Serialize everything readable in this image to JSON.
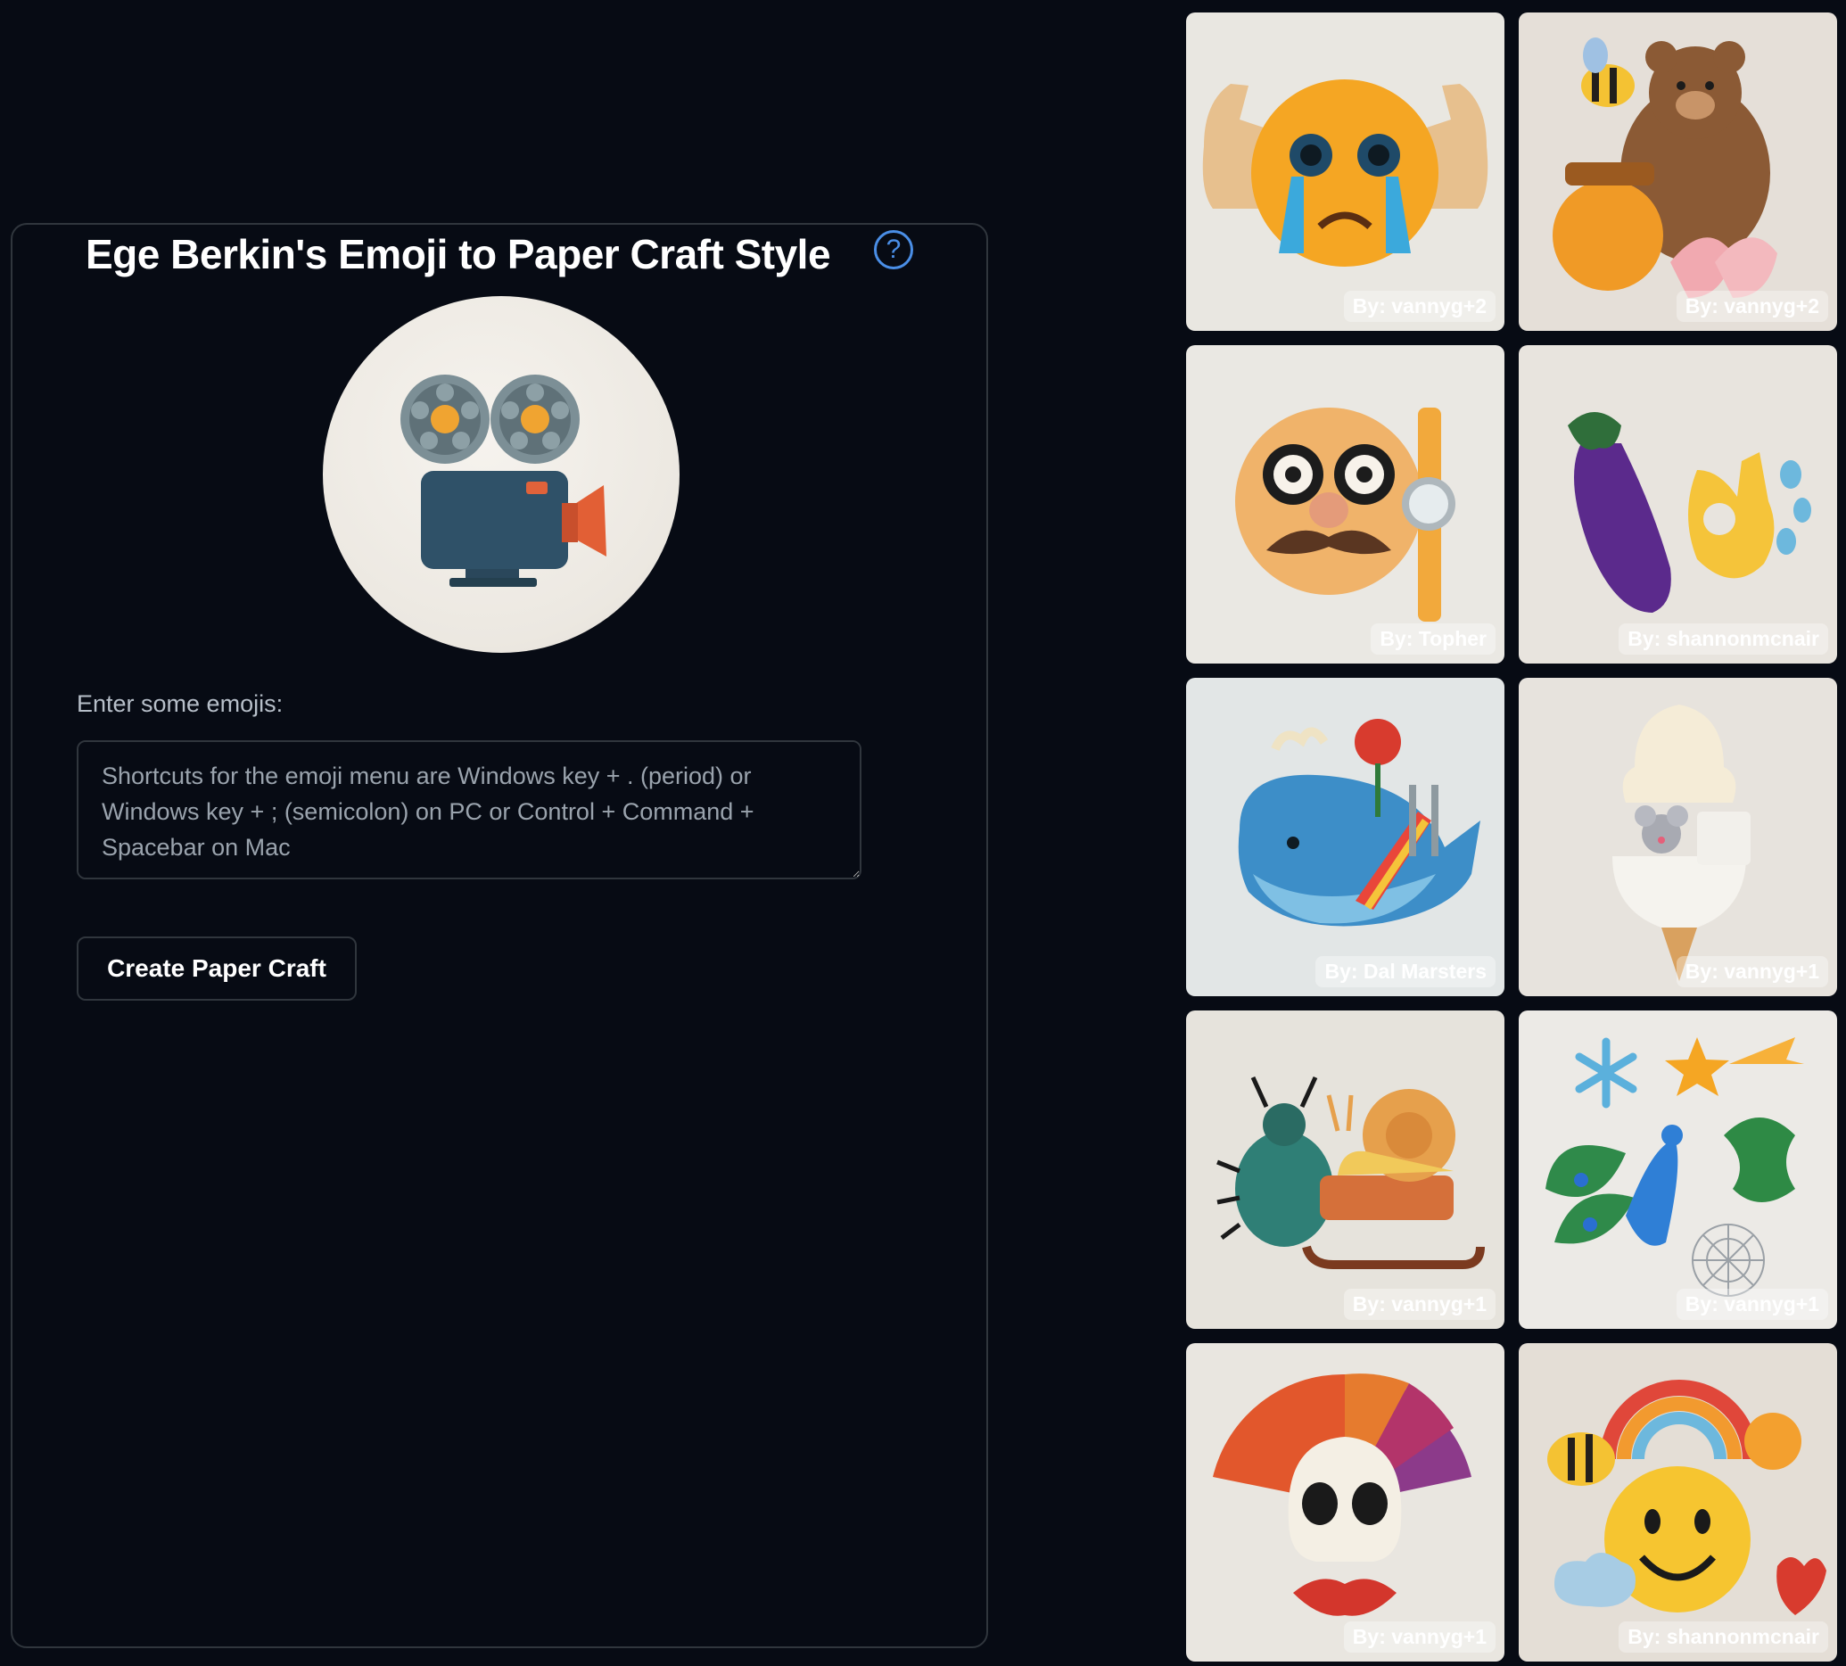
{
  "app": {
    "title": "Ege Berkin's Emoji to Paper Craft Style",
    "help_icon": "question-circle-icon",
    "accent_color": "#4a8ee6",
    "background_color": "#070b14"
  },
  "preview": {
    "subject": "film-projector-icon"
  },
  "form": {
    "label": "Enter some emojis:",
    "placeholder": "Shortcuts for the emoji menu are Windows key + . (period) or Windows key + ; (semicolon) on PC or Control + Command + Spacebar on Mac",
    "value": "",
    "submit_label": "Create Paper Craft"
  },
  "gallery": [
    {
      "author": "By: vannyg+2",
      "subject": "crying-face-flexed-biceps-icon"
    },
    {
      "author": "By: vannyg+2",
      "subject": "bee-bear-honey-ballet-shoes-icon"
    },
    {
      "author": "By: Topher",
      "subject": "disguised-face-watch-icon"
    },
    {
      "author": "By: shannonmcnair",
      "subject": "eggplant-ok-hand-droplets-icon"
    },
    {
      "author": "By: Dal Marsters",
      "subject": "whale-rose-slide-icon"
    },
    {
      "author": "By: vannyg+1",
      "subject": "ice-cream-mouse-toilet-icon"
    },
    {
      "author": "By: vannyg+1",
      "subject": "beetle-snail-sled-icon"
    },
    {
      "author": "By: vannyg+1",
      "subject": "snowflake-star-peacock-dragon-web-icon"
    },
    {
      "author": "By: vannyg+1",
      "subject": "skull-fan-lips-icon"
    },
    {
      "author": "By: shannonmcnair",
      "subject": "bee-rainbow-smiley-sun-heart-icon"
    }
  ]
}
